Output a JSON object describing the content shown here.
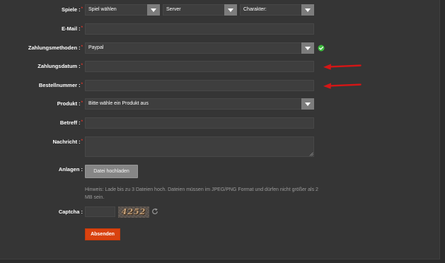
{
  "colors": {
    "frame_bg": "#2b2b2b",
    "page_bg": "#353535",
    "field_bg": "#3e3e3e",
    "field_border": "#474747",
    "dropdown_button": "#7c7c7c",
    "label": "#ffffff",
    "required": "#e2352a",
    "hint": "#9c9c9c",
    "upload_bg": "#868686",
    "submit_bg": "#d9420f",
    "valid": "#3dbb3d",
    "annotation_arrow": "#d41616"
  },
  "games": {
    "label": "Spiele :",
    "required": "*",
    "game_select": {
      "value": "Spiel wählen",
      "icon": "chevron-down-icon"
    },
    "server_select": {
      "value": "Server",
      "icon": "chevron-down-icon"
    },
    "character_select": {
      "value": "Charakter:",
      "icon": "chevron-down-icon"
    }
  },
  "email": {
    "label": "E-Mail :",
    "required": "*",
    "value": ""
  },
  "payment_method": {
    "label": "Zahlungsmethoden :",
    "required": "*",
    "value": "Paypal",
    "icon": "chevron-down-icon",
    "status_icon": "check-circle-icon"
  },
  "payment_date": {
    "label": "Zahlungsdatum :",
    "required": "*",
    "value": ""
  },
  "order_number": {
    "label": "Bestellnummer :",
    "required": "*",
    "value": ""
  },
  "product": {
    "label": "Produkt :",
    "required": "*",
    "value": "Bitte wähle ein Produkt aus",
    "icon": "chevron-down-icon"
  },
  "subject": {
    "label": "Betreff :",
    "required": "*",
    "value": ""
  },
  "message": {
    "label": "Nachricht :",
    "required": "*",
    "value": ""
  },
  "attachments": {
    "label": "Anlagen :",
    "button_label": "Datei hochladen",
    "hint": "Hinweis: Lade bis zu 3 Dateien hoch. Dateien müssen im JPEG/PNG Format und dürfen nicht größer als 2 MB sein."
  },
  "captcha": {
    "label": "Captcha :",
    "value": "",
    "code": "4252",
    "refresh_icon": "refresh-icon"
  },
  "submit": {
    "label": "Absenden"
  }
}
